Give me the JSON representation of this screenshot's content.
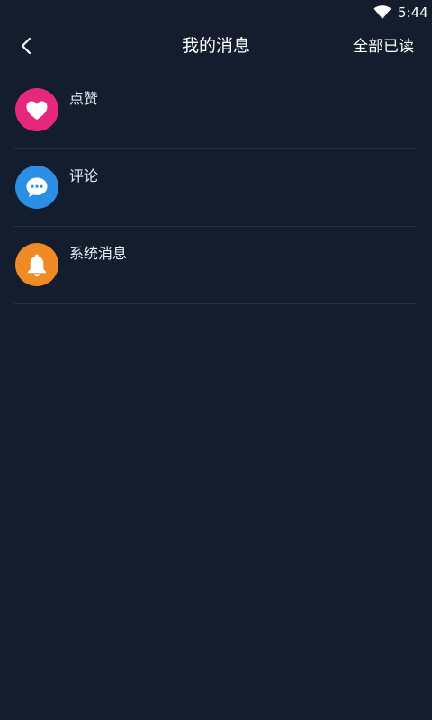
{
  "status_bar": {
    "time": "5:44",
    "wifi_icon": "wifi-icon"
  },
  "header": {
    "back_icon": "chevron-left-icon",
    "title": "我的消息",
    "mark_all_read": "全部已读"
  },
  "message_list": {
    "items": [
      {
        "label": "点赞",
        "icon": "heart-icon",
        "color": "#e5287e"
      },
      {
        "label": "评论",
        "icon": "chat-bubble-icon",
        "color": "#2b8fe6"
      },
      {
        "label": "系统消息",
        "icon": "bell-icon",
        "color": "#ef8a25"
      }
    ]
  },
  "colors": {
    "background": "#131d2d",
    "divider": "#243043",
    "text": "#e8ecf2"
  }
}
